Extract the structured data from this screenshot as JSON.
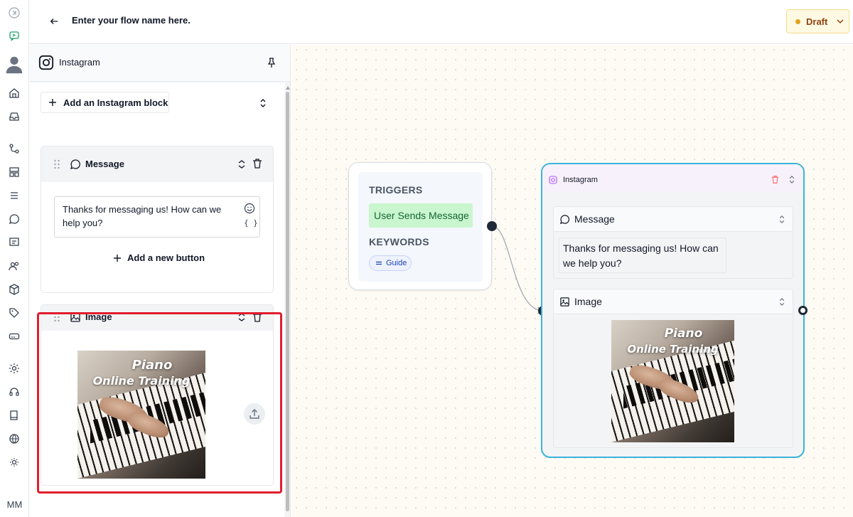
{
  "header": {
    "flow_title": "Enter your flow name here.",
    "status": "Draft"
  },
  "rail": {
    "initials": "MM"
  },
  "panel": {
    "channel_name": "Instagram",
    "add_block_label": "Add an Instagram block",
    "message_block": {
      "title": "Message",
      "text": "Thanks for messaging us! How can we help you?",
      "braces": "{ }",
      "add_button_label": "Add a new button"
    },
    "image_block": {
      "title": "Image",
      "image_caption_line1": "Piano",
      "image_caption_line2": "Online Training"
    }
  },
  "canvas": {
    "trigger_node": {
      "triggers_label": "TRIGGERS",
      "trigger_value": "User Sends Message",
      "keywords_label": "KEYWORDS",
      "keyword_value": "Guide"
    },
    "instagram_node": {
      "title": "Instagram",
      "message_title": "Message",
      "message_text": "Thanks for messaging us! How can we help you?",
      "image_title": "Image",
      "image_caption_line1": "Piano",
      "image_caption_line2": "Online Training"
    }
  },
  "colors": {
    "accent_border": "#3bb3d9",
    "highlight": "#e11d2d",
    "trigger_pill": "#c9f6cf",
    "draft_bg": "#fef9e3"
  }
}
